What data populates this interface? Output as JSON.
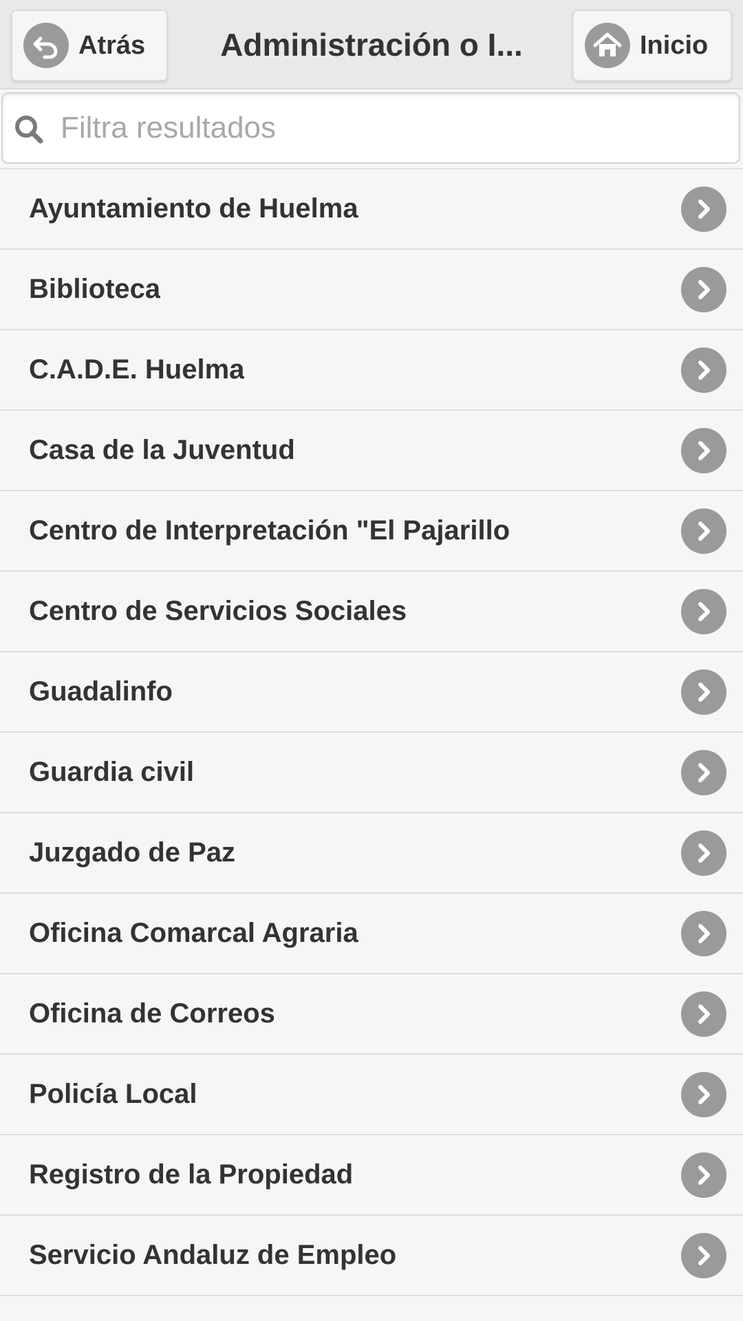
{
  "header": {
    "back_label": "Atrás",
    "title": "Administración o I...",
    "home_label": "Inicio"
  },
  "search": {
    "placeholder": "Filtra resultados",
    "value": ""
  },
  "list": {
    "items": [
      {
        "label": "Ayuntamiento de Huelma"
      },
      {
        "label": "Biblioteca"
      },
      {
        "label": "C.A.D.E. Huelma"
      },
      {
        "label": "Casa de la Juventud"
      },
      {
        "label": "Centro de Interpretación \"El Pajarillo"
      },
      {
        "label": "Centro de Servicios Sociales"
      },
      {
        "label": "Guadalinfo"
      },
      {
        "label": "Guardia civil"
      },
      {
        "label": "Juzgado de Paz"
      },
      {
        "label": "Oficina Comarcal Agraria"
      },
      {
        "label": "Oficina de Correos"
      },
      {
        "label": "Policía Local"
      },
      {
        "label": "Registro de la Propiedad"
      },
      {
        "label": "Servicio Andaluz de Empleo"
      }
    ]
  },
  "icons": {
    "back": "undo-arrow-icon",
    "home": "home-icon",
    "search": "search-icon",
    "row_chevron": "chevron-right-icon"
  },
  "colors": {
    "header_bg": "#e9e9e9",
    "list_bg": "#f6f6f6",
    "icon_bg": "#9a9a9a",
    "text": "#333333",
    "placeholder": "#a8a8a8"
  }
}
